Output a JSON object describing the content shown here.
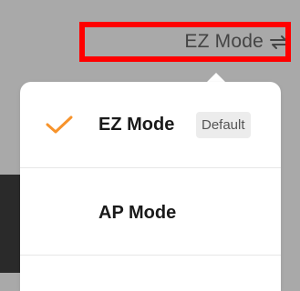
{
  "header": {
    "mode_switch_label": "EZ Mode",
    "mode_switch_icon": "swap-arrows-icon"
  },
  "menu": {
    "items": [
      {
        "label": "EZ Mode",
        "badge": "Default",
        "selected": true,
        "icon": "check-icon"
      },
      {
        "label": "AP Mode",
        "selected": false
      }
    ]
  },
  "colors": {
    "background": "#a9a9a9",
    "highlight": "#ff0000",
    "check": "#f7932b",
    "badge_bg": "#ececec"
  }
}
